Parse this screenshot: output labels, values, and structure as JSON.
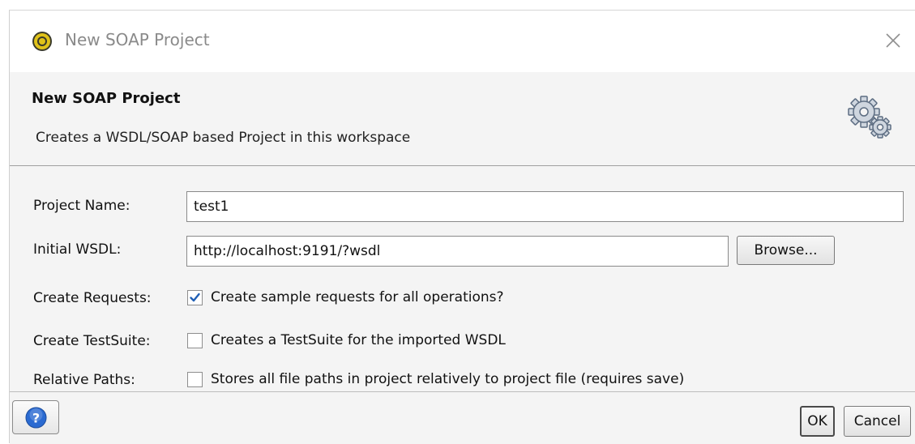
{
  "window": {
    "title": "New SOAP Project",
    "app_icon": "soapui-icon",
    "close_icon": "close-icon"
  },
  "header": {
    "title": "New SOAP Project",
    "description": "Creates a WSDL/SOAP based Project in this workspace",
    "icon": "gear-icon"
  },
  "form": {
    "project_name": {
      "label": "Project Name:",
      "value": "test1"
    },
    "initial_wsdl": {
      "label": "Initial WSDL:",
      "value": "http://localhost:9191/?wsdl",
      "browse_label": "Browse..."
    },
    "create_requests": {
      "label": "Create Requests:",
      "checkbox_text": "Create sample requests for all operations?",
      "checked": true
    },
    "create_testsuite": {
      "label": "Create TestSuite:",
      "checkbox_text": "Creates a TestSuite for the imported WSDL",
      "checked": false
    },
    "relative_paths": {
      "label": "Relative Paths:",
      "checkbox_text": "Stores all file paths in project relatively to project file (requires save)",
      "checked": false
    }
  },
  "footer": {
    "help_icon": "help-icon",
    "ok_label": "OK",
    "cancel_label": "Cancel"
  },
  "colors": {
    "panel_bg": "#f4f4f4",
    "check_blue": "#1f5fb5",
    "help_blue": "#2a6ad1",
    "soapui_yellow": "#e0c219"
  }
}
